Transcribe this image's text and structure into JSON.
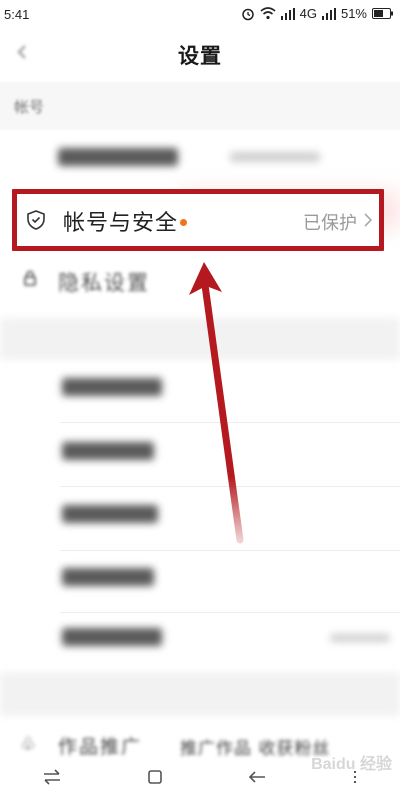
{
  "status_bar": {
    "time": "5:41",
    "network": "4G",
    "battery": "51%"
  },
  "header": {
    "title": "设置",
    "back_icon": "back-arrow-icon"
  },
  "section_account": {
    "label": "帐号"
  },
  "highlighted_item": {
    "label": "帐号与安全",
    "status": "已保护",
    "icon": "shield-check-icon",
    "dot_color": "#f0731e"
  },
  "privacy_item": {
    "label": "隐私设置",
    "icon": "lock-icon"
  },
  "bottom_item": {
    "label": "作品推广",
    "extra": "推广作品 收获粉丝"
  },
  "annotation": {
    "box_color": "#b3191f",
    "arrow_color": "#b3191f"
  },
  "watermark": "Baidu 经验"
}
